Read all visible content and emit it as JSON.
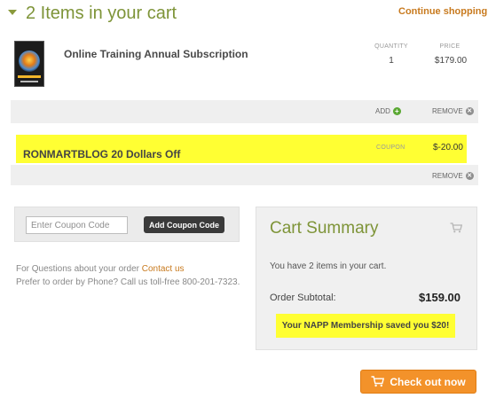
{
  "header": {
    "cart_title": "2 Items in your cart",
    "continue_label": "Continue shopping"
  },
  "item": {
    "name": "Online Training Annual Subscription",
    "qty_header": "QUANTITY",
    "price_header": "PRICE",
    "quantity": "1",
    "price": "$179.00",
    "add_label": "ADD",
    "remove_label": "REMOVE"
  },
  "coupon_line": {
    "name": "RONMARTBLOG 20 Dollars Off",
    "label": "COUPON",
    "amount": "$-20.00",
    "remove_label": "REMOVE"
  },
  "coupon_entry": {
    "placeholder": "Enter Coupon Code",
    "button_label": "Add Coupon Code"
  },
  "help": {
    "questions_text": "For Questions about your order",
    "contact_label": "Contact us",
    "phone_text": "Prefer to order by Phone? Call us toll-free 800-201-7323."
  },
  "summary": {
    "title": "Cart Summary",
    "count_text": "You have 2 items in your cart.",
    "subtotal_label": "Order Subtotal:",
    "subtotal_value": "$159.00",
    "savings_text": "Your NAPP Membership saved you $20!"
  },
  "checkout": {
    "label": "Check out now"
  },
  "icons": {
    "caret": "chevron-down-icon",
    "add": "plus-circle-icon",
    "remove": "close-circle-icon",
    "cart": "cart-icon"
  },
  "colors": {
    "title_green": "#7e9438",
    "link_orange": "#c87a1e",
    "highlight_yellow": "#ffff33",
    "checkout_orange": "#f3922a"
  }
}
